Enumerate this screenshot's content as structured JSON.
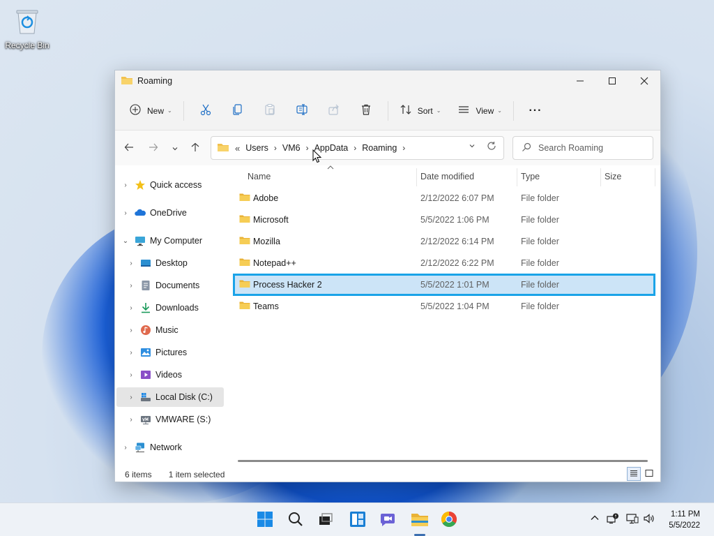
{
  "desktop": {
    "recycle_bin_label": "Recycle Bin"
  },
  "window": {
    "title": "Roaming",
    "controls": {
      "minimize": "—",
      "maximize": "☐",
      "close": "✕"
    }
  },
  "command_bar": {
    "new_label": "New",
    "sort_label": "Sort",
    "view_label": "View",
    "more_label": "···"
  },
  "address": {
    "overflow": "«",
    "crumbs": [
      "Users",
      "VM6",
      "AppData",
      "Roaming"
    ],
    "search_placeholder": "Search Roaming"
  },
  "sidebar": {
    "items": [
      {
        "label": "Quick access",
        "icon": "star-icon"
      },
      {
        "label": "OneDrive",
        "icon": "cloud-icon"
      },
      {
        "label": "My Computer",
        "icon": "computer-icon"
      },
      {
        "label": "Desktop",
        "icon": "desktop-icon"
      },
      {
        "label": "Documents",
        "icon": "documents-icon"
      },
      {
        "label": "Downloads",
        "icon": "downloads-icon"
      },
      {
        "label": "Music",
        "icon": "music-icon"
      },
      {
        "label": "Pictures",
        "icon": "pictures-icon"
      },
      {
        "label": "Videos",
        "icon": "videos-icon"
      },
      {
        "label": "Local Disk (C:)",
        "icon": "drive-icon"
      },
      {
        "label": "VMWARE (S:)",
        "icon": "network-drive-icon"
      },
      {
        "label": "Network",
        "icon": "network-icon"
      }
    ]
  },
  "columns": {
    "name": "Name",
    "date": "Date modified",
    "type": "Type",
    "size": "Size"
  },
  "files": [
    {
      "name": "Adobe",
      "date": "2/12/2022 6:07 PM",
      "type": "File folder"
    },
    {
      "name": "Microsoft",
      "date": "5/5/2022 1:06 PM",
      "type": "File folder"
    },
    {
      "name": "Mozilla",
      "date": "2/12/2022 6:14 PM",
      "type": "File folder"
    },
    {
      "name": "Notepad++",
      "date": "2/12/2022 6:22 PM",
      "type": "File folder"
    },
    {
      "name": "Process Hacker 2",
      "date": "5/5/2022 1:01 PM",
      "type": "File folder"
    },
    {
      "name": "Teams",
      "date": "5/5/2022 1:04 PM",
      "type": "File folder"
    }
  ],
  "status": {
    "items": "6 items",
    "selected": "1 item selected"
  },
  "taskbar": {
    "time": "1:11 PM",
    "date": "5/5/2022"
  },
  "colors": {
    "accent": "#1aa3e8",
    "selection": "#cce4f7",
    "folder": "#f2c14e"
  }
}
